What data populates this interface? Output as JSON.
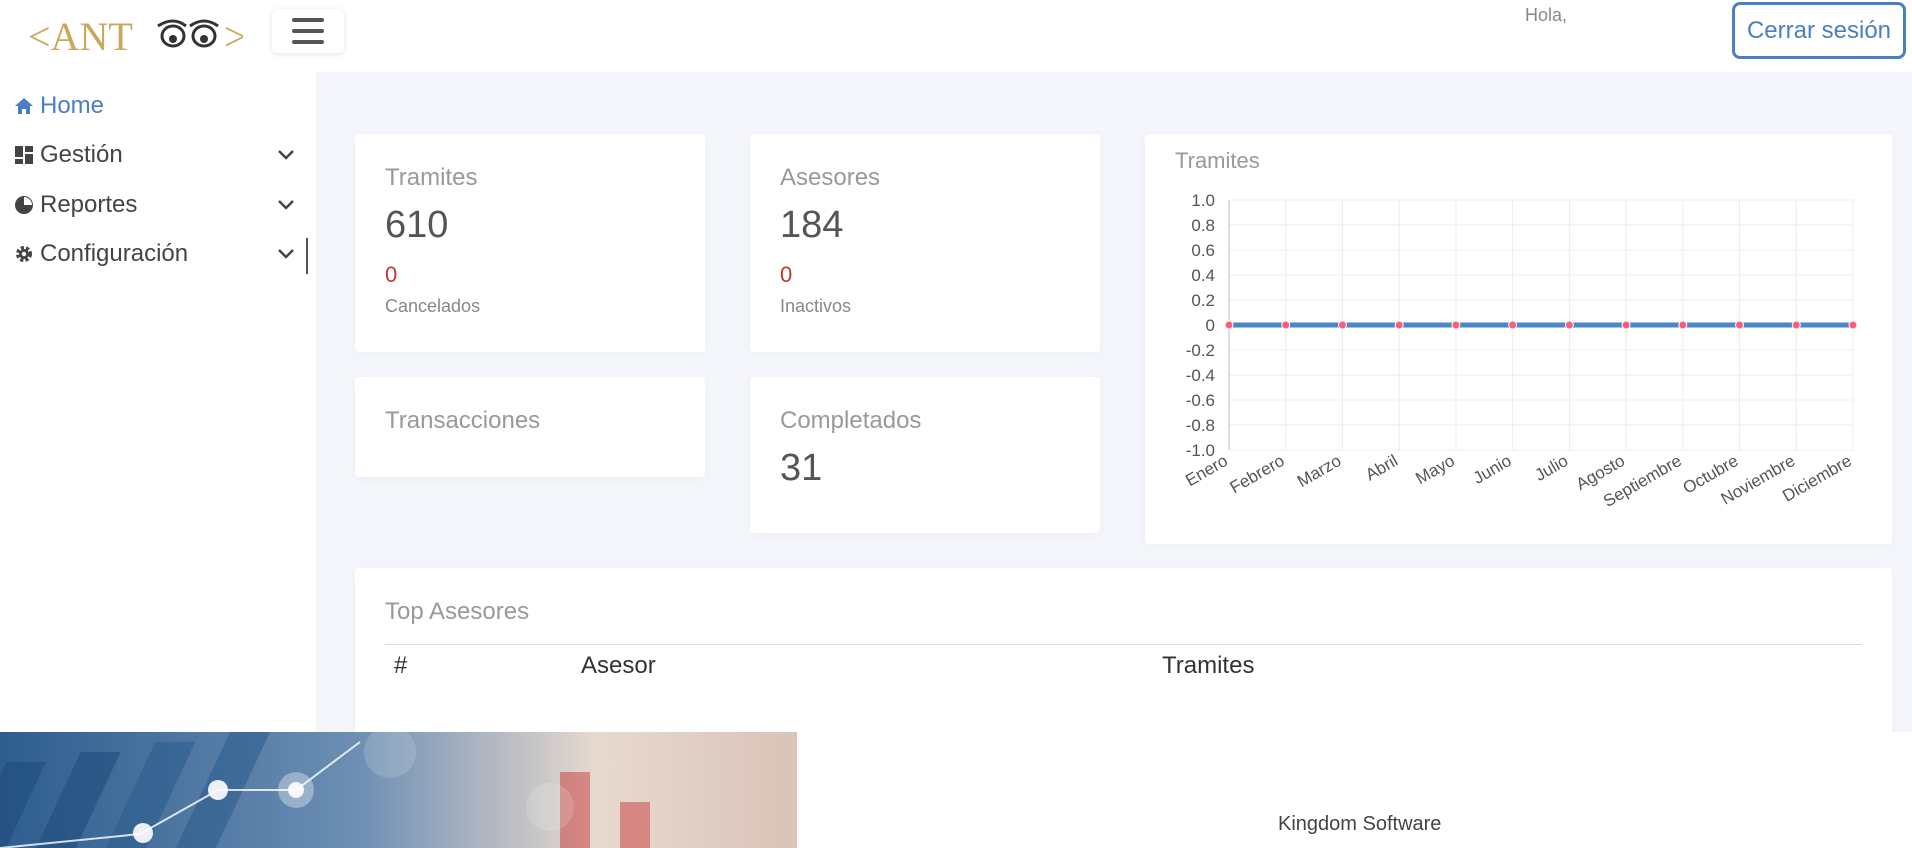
{
  "header": {
    "logo_text": "<ANT>",
    "greeting": "Hola,",
    "logout_label": "Cerrar sesión"
  },
  "sidebar": {
    "items": [
      {
        "label": "Home",
        "icon": "home-icon",
        "active": true
      },
      {
        "label": "Gestión",
        "icon": "dashboard-icon",
        "expandable": true
      },
      {
        "label": "Reportes",
        "icon": "chart-icon",
        "expandable": true
      },
      {
        "label": "Configuración",
        "icon": "gear-icon",
        "expandable": true
      }
    ]
  },
  "cards": {
    "tramites": {
      "title": "Tramites",
      "value": "610",
      "sub_value": "0",
      "sub_label": "Cancelados"
    },
    "asesores": {
      "title": "Asesores",
      "value": "184",
      "sub_value": "0",
      "sub_label": "Inactivos"
    },
    "transacciones": {
      "title": "Transacciones"
    },
    "completados": {
      "title": "Completados",
      "value": "31"
    }
  },
  "chart_card": {
    "title": "Tramites"
  },
  "chart_data": {
    "type": "line",
    "categories": [
      "Enero",
      "Febrero",
      "Marzo",
      "Abril",
      "Mayo",
      "Junio",
      "Julio",
      "Agosto",
      "Septiembre",
      "Octubre",
      "Noviembre",
      "Diciembre"
    ],
    "series": [
      {
        "values": [
          0,
          0,
          0,
          0,
          0,
          0,
          0,
          0,
          0,
          0,
          0,
          0
        ],
        "color": "#4a86c8",
        "point_color": "#ff5c7a"
      }
    ],
    "yticks": [
      "1.0",
      "0.8",
      "0.6",
      "0.4",
      "0.2",
      "0",
      "-0.2",
      "-0.4",
      "-0.6",
      "-0.8",
      "-1.0"
    ],
    "ylim": [
      -1,
      1
    ],
    "grid": true,
    "title": "Tramites"
  },
  "top_asesores": {
    "title": "Top Asesores",
    "columns": [
      "#",
      "Asesor",
      "Tramites"
    ]
  },
  "footer": {
    "text": "Kingdom Software"
  },
  "colors": {
    "accent": "#4a7fc1",
    "logo_gold": "#c9a85c",
    "alert": "#c0392b",
    "background": "#f4f6fb"
  }
}
